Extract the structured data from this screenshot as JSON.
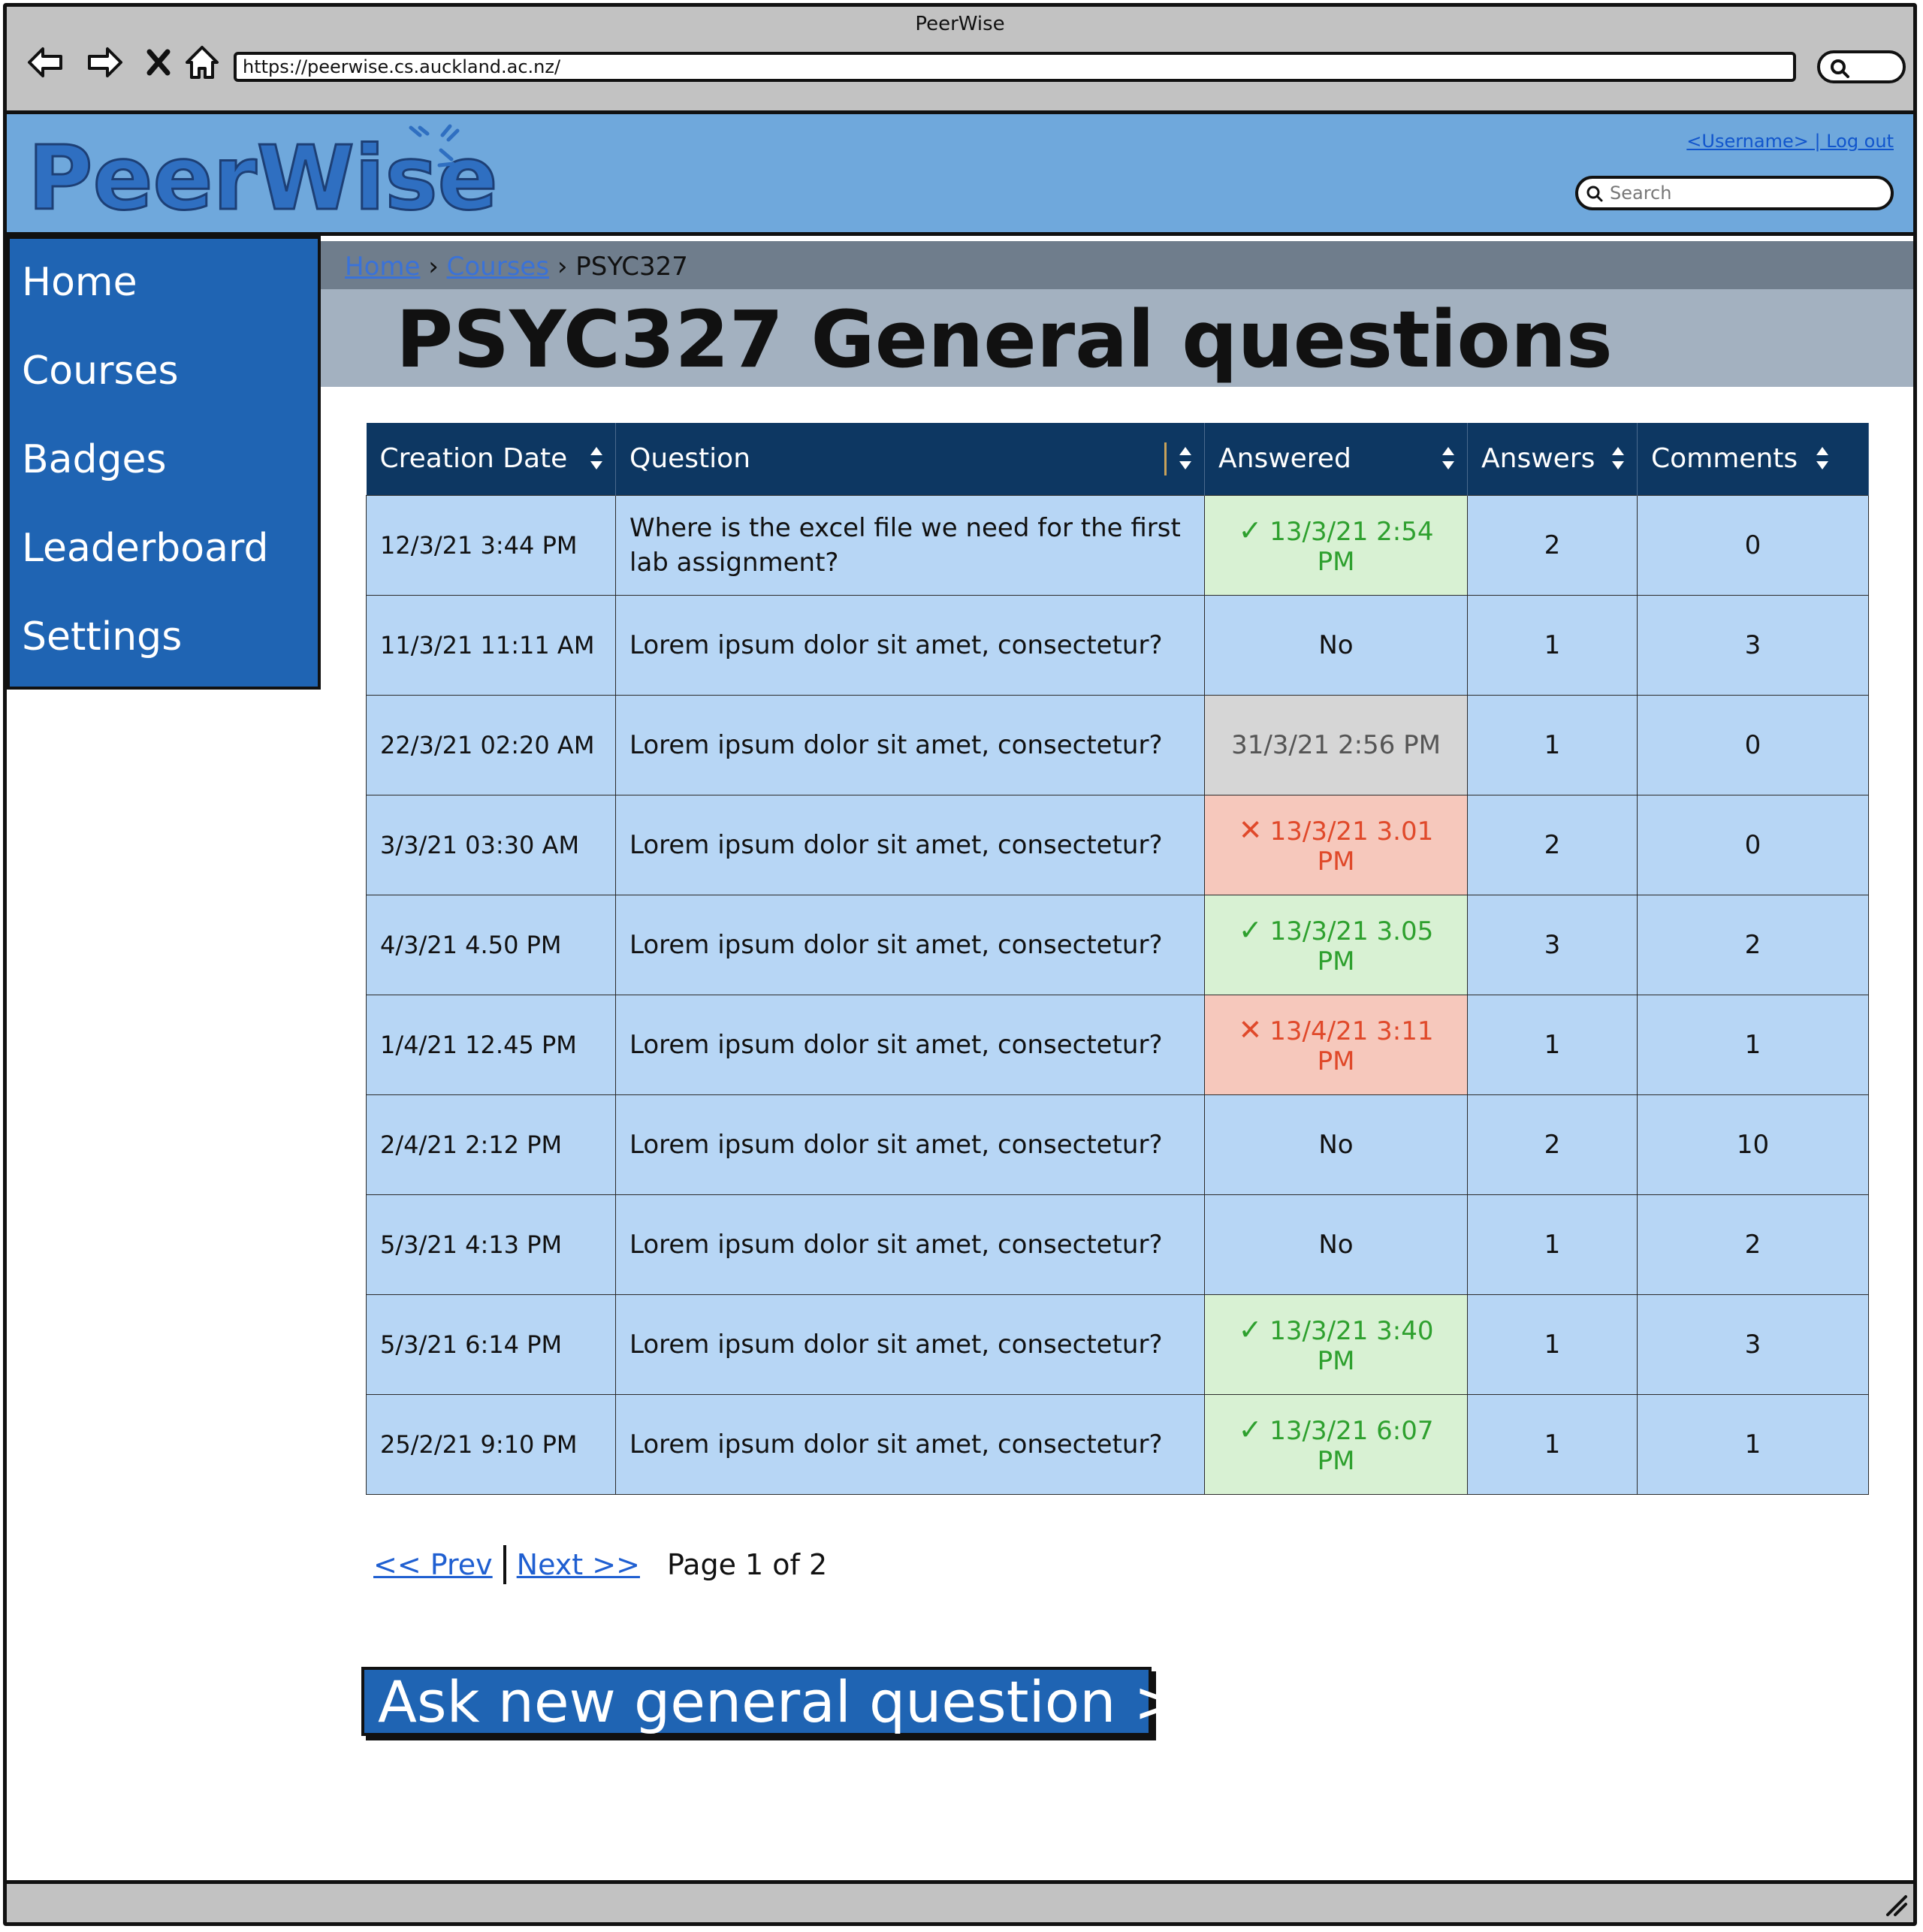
{
  "browser": {
    "window_title": "PeerWise",
    "url": "https://peerwise.cs.auckland.ac.nz/"
  },
  "header": {
    "logo_text": "PeerWise",
    "user_links": "<Username> | Log out",
    "search_placeholder": "Search",
    "brand_color": "#6fa8dc"
  },
  "sidebar": {
    "items": [
      {
        "label": "Home"
      },
      {
        "label": "Courses"
      },
      {
        "label": "Badges"
      },
      {
        "label": "Leaderboard"
      },
      {
        "label": "Settings"
      }
    ]
  },
  "breadcrumb": {
    "items": [
      "Home",
      "Courses",
      "PSYC327"
    ]
  },
  "page": {
    "title": "PSYC327 General questions"
  },
  "table": {
    "columns": [
      "Creation Date",
      "Question",
      "Answered",
      "Answers",
      "Comments"
    ],
    "rows": [
      {
        "date": "12/3/21 3:44 PM",
        "question": "Where is the excel file we need for the first lab assignment?",
        "answered": "13/3/21 2:54 PM",
        "status": "correct",
        "answers": "2",
        "comments": "0"
      },
      {
        "date": "11/3/21 11:11 AM",
        "question": "Lorem ipsum dolor sit amet, consectetur?",
        "answered": "No",
        "status": "no",
        "answers": "1",
        "comments": "3"
      },
      {
        "date": "22/3/21 02:20 AM",
        "question": "Lorem ipsum dolor sit amet, consectetur?",
        "answered": "31/3/21 2:56 PM",
        "status": "pending",
        "answers": "1",
        "comments": "0"
      },
      {
        "date": "3/3/21 03:30 AM",
        "question": "Lorem ipsum dolor sit amet, consectetur?",
        "answered": "13/3/21 3.01 PM",
        "status": "wrong",
        "answers": "2",
        "comments": "0"
      },
      {
        "date": "4/3/21 4.50 PM",
        "question": "Lorem ipsum dolor sit amet, consectetur?",
        "answered": "13/3/21 3.05 PM",
        "status": "correct",
        "answers": "3",
        "comments": "2"
      },
      {
        "date": "1/4/21  12.45 PM",
        "question": "Lorem ipsum dolor sit amet, consectetur?",
        "answered": "13/4/21 3:11 PM",
        "status": "wrong",
        "answers": "1",
        "comments": "1"
      },
      {
        "date": "2/4/21  2:12 PM",
        "question": "Lorem ipsum dolor sit amet, consectetur?",
        "answered": "No",
        "status": "no",
        "answers": "2",
        "comments": "10"
      },
      {
        "date": "5/3/21  4:13 PM",
        "question": "Lorem ipsum dolor sit amet, consectetur?",
        "answered": "No",
        "status": "no",
        "answers": "1",
        "comments": "2"
      },
      {
        "date": "5/3/21  6:14 PM",
        "question": "Lorem ipsum dolor sit amet, consectetur?",
        "answered": "13/3/21 3:40 PM",
        "status": "correct",
        "answers": "1",
        "comments": "3"
      },
      {
        "date": "25/2/21 9:10 PM",
        "question": "Lorem ipsum dolor sit amet, consectetur?",
        "answered": "13/3/21 6:07 PM",
        "status": "correct",
        "answers": "1",
        "comments": "1"
      }
    ]
  },
  "pagination": {
    "prev_label": "<< Prev",
    "next_label": "Next >>",
    "page_info": "Page 1 of 2"
  },
  "cta": {
    "label": "Ask new general question >"
  },
  "colors": {
    "sidebar": "#1f64b3",
    "table_header": "#0d3762",
    "row_bg": "#b7d6f5",
    "correct": "#2ea02e",
    "wrong": "#e0492a",
    "pending": "#d6d6d6"
  }
}
